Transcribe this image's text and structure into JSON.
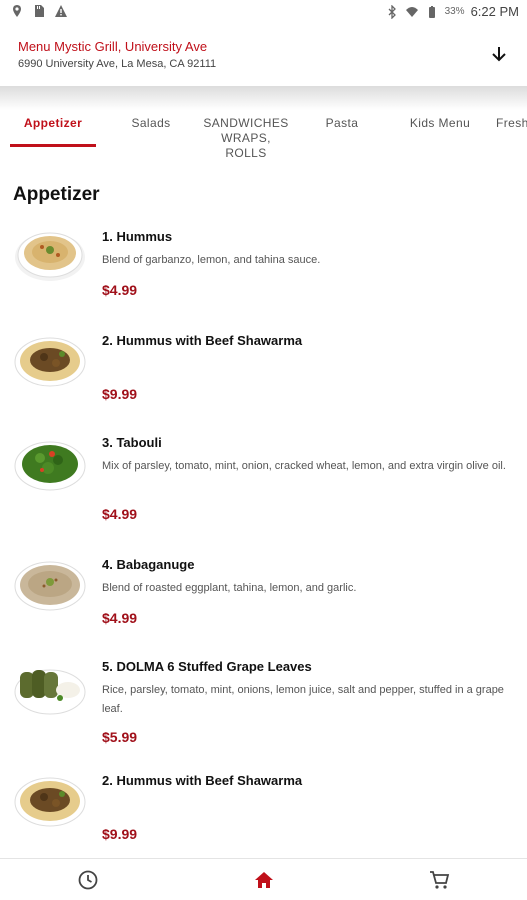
{
  "status_bar": {
    "battery": "33%",
    "time": "6:22 PM",
    "left_icons": [
      "location-icon",
      "sd-card-icon",
      "warning-icon"
    ],
    "right_icons": [
      "bluetooth-icon",
      "wifi-icon",
      "battery-icon"
    ]
  },
  "header": {
    "menu_word": "Menu",
    "restaurant": "Mystic Grill, University Ave",
    "address": "6990 University Ave, La Mesa, CA 92111",
    "arrow_icon": "arrow-down-icon"
  },
  "tabs": [
    {
      "label": "Appetizer",
      "active": true
    },
    {
      "label": "Salads",
      "active": false
    },
    {
      "label": "SANDWICHES\nWRAPS,\nROLLS",
      "active": false
    },
    {
      "label": "Pasta",
      "active": false
    },
    {
      "label": "Kids Menu",
      "active": false
    },
    {
      "label": "Fresh",
      "active": false
    }
  ],
  "section": {
    "title": "Appetizer",
    "items": [
      {
        "name": "1. Hummus",
        "desc": "Blend of garbanzo, lemon, and tahina sauce.",
        "price": "$4.99"
      },
      {
        "name": "2. Hummus with Beef Shawarma",
        "desc": "",
        "price": "$9.99"
      },
      {
        "name": "3. Tabouli",
        "desc": "Mix of parsley, tomato, mint, onion, cracked wheat, lemon, and extra virgin olive oil.",
        "price": "$4.99"
      },
      {
        "name": "4. Babaganuge",
        "desc": "Blend of roasted eggplant, tahina, lemon, and garlic.",
        "price": "$4.99"
      },
      {
        "name": "5. DOLMA 6 Stuffed Grape Leaves",
        "desc": "Rice, parsley, tomato, mint, onions, lemon juice, salt and pepper, stuffed in a grape leaf.",
        "price": "$5.99"
      },
      {
        "name": "2. Hummus with Beef Shawarma",
        "desc": "",
        "price": "$9.99"
      }
    ]
  },
  "bottom_nav": {
    "items": [
      "history-icon",
      "home-icon",
      "cart-icon"
    ],
    "active_color": "#c0101a",
    "inactive_color": "#444444"
  },
  "colors": {
    "accent": "#c0101a",
    "price": "#a0101a"
  }
}
